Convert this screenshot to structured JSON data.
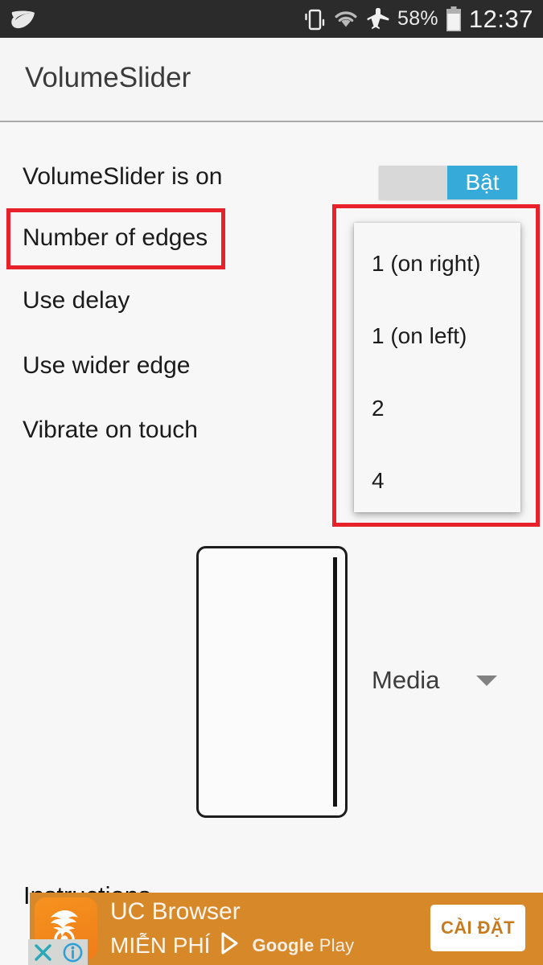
{
  "statusbar": {
    "leaf_icon": "leaf-icon",
    "vibrate_icon": "vibrate-icon",
    "wifi_icon": "wifi-icon",
    "airplane_icon": "airplane-mode-icon",
    "battery_percent": "58%",
    "battery_icon": "battery-icon",
    "clock": "12:37"
  },
  "actionbar": {
    "title": "VolumeSlider"
  },
  "preferences": [
    {
      "label": "VolumeSlider is on"
    },
    {
      "label": "Number of edges"
    },
    {
      "label": "Use delay"
    },
    {
      "label": "Use wider edge"
    },
    {
      "label": "Vibrate on touch"
    }
  ],
  "toggle": {
    "on_label": "Bật",
    "state": "on",
    "accent": "#36aad8",
    "track": "#d8d8d8"
  },
  "dropdown": {
    "options": [
      "1 (on right)",
      "1 (on left)",
      "2",
      "4"
    ]
  },
  "highlights": {
    "color": "#e8222a"
  },
  "preview": {
    "edge_side": "right"
  },
  "stream_spinner": {
    "value": "Media",
    "caret_icon": "chevron-down-icon"
  },
  "instructions": {
    "heading": "Instructions"
  },
  "ad": {
    "icon": "uc-browser-icon",
    "title": "UC Browser",
    "free_label": "MIỄN PHÍ",
    "store_icon": "google-play-icon",
    "store_brand": "Google",
    "store_brand_suffix": " Play",
    "cta": "CÀI ĐẶT",
    "close_icon": "close-icon",
    "info_icon": "info-icon",
    "background": "#d7892a"
  }
}
